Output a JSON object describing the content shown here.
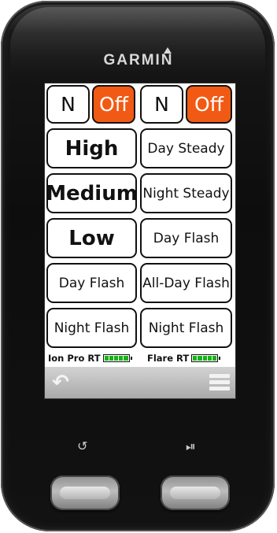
{
  "device": {
    "brand": "GARMIN"
  },
  "left_column": {
    "top_left": "N",
    "top_right": "Off",
    "modes": [
      "High",
      "Medium",
      "Low",
      "Day Flash",
      "Night Flash"
    ],
    "status_label": "Ion Pro RT"
  },
  "right_column": {
    "top_left": "N",
    "top_right": "Off",
    "modes": [
      "Day Steady",
      "Night Steady",
      "Day Flash",
      "All-Day Flash",
      "Night Flash"
    ],
    "status_label": "Flare RT"
  },
  "batteries": {
    "left_level": 1.0,
    "right_level": 1.0,
    "color": "#17b317"
  },
  "colors": {
    "accent": "#f15a14"
  },
  "icons": {
    "back": "back-arrow-icon",
    "menu": "menu-icon",
    "loop": "loop-icon",
    "play": "play-icon"
  }
}
